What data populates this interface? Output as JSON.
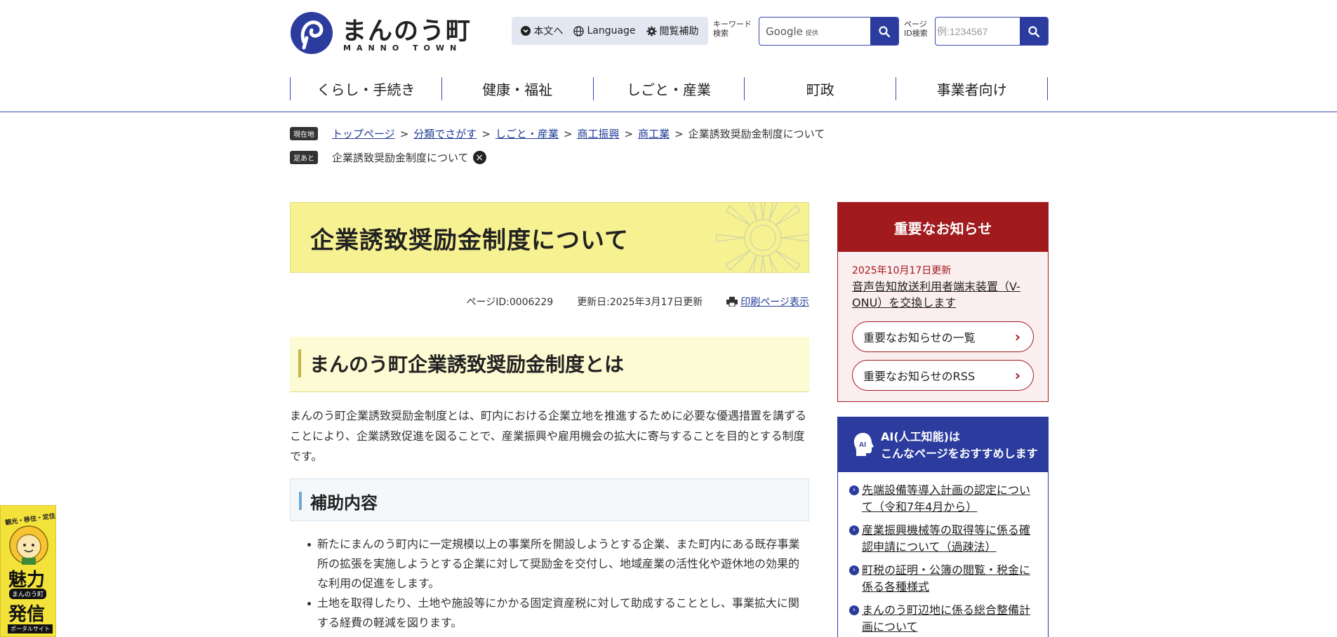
{
  "header": {
    "logo_title": "まんのう町",
    "logo_sub": "MANNO TOWN",
    "util": {
      "main_text": "本文へ",
      "language": "Language",
      "assist": "閲覧補助"
    },
    "keyword_label": "キーワード検索",
    "search_provider": "Google",
    "search_provider_sub": "提供",
    "pageid_label": "ページID検索",
    "pageid_placeholder": "例:1234567",
    "nav": [
      "くらし・手続き",
      "健康・福祉",
      "しごと・産業",
      "町政",
      "事業者向け"
    ],
    "accent_color": "#2b3c9e"
  },
  "breadcrumb": {
    "current_tag": "現在地",
    "trail": [
      "トップページ",
      "分類でさがす",
      "しごと・産業",
      "商工振興",
      "商工業"
    ],
    "current": "企業誘致奨励金制度について",
    "footprint_tag": "足あと",
    "footprint_item": "企業誘致奨励金制度について"
  },
  "main": {
    "title": "企業誘致奨励金制度について",
    "page_id": "ページID:0006229",
    "updated": "更新日:2025年3月17日更新",
    "print": "印刷ページ表示",
    "h2": "まんのう町企業誘致奨励金制度とは",
    "para": "まんのう町企業誘致奨励金制度とは、町内における企業立地を推進するために必要な優遇措置を講ずることにより、企業誘致促進を図ることで、産業振興や雇用機会の拡大に寄与することを目的とする制度です。",
    "h3": "補助内容",
    "bullets": [
      "新たにまんのう町内に一定規模以上の事業所を開設しようとする企業、また町内にある既存事業所の拡張を実施しようとする企業に対して奨励金を交付し、地域産業の活性化や遊休地の効果的な利用の促進をします。",
      "土地を取得したり、土地や施設等にかかる固定資産税に対して助成することとし、事業拡大に関する経費の軽減を図ります。"
    ]
  },
  "sidebar": {
    "notice": {
      "heading": "重要なお知らせ",
      "date": "2025年10月17日更新",
      "link": "音声告知放送利用者端末装置（V-ONU）を交換します",
      "btn_list": "重要なお知らせの一覧",
      "btn_rss": "重要なお知らせのRSS",
      "color": "#a01a1e"
    },
    "ai": {
      "icon_text": "AI",
      "heading_line1": "AI(人工知能)は",
      "heading_line2": "こんなページをおすすめします",
      "items": [
        "先端設備等導入計画の認定について（令和7年4月から）",
        "産業振興機械等の取得等に係る確認申請について（過疎法）",
        "町税の証明・公簿の閲覧・税金に係る各種様式",
        "まんのう町辺地に係る総合整備計画について"
      ]
    }
  },
  "float_banner": {
    "top": "観光・移住・定住",
    "big1": "魅力",
    "mid": "まんのう町",
    "big2": "発信",
    "bottom": "ポータルサイト"
  }
}
